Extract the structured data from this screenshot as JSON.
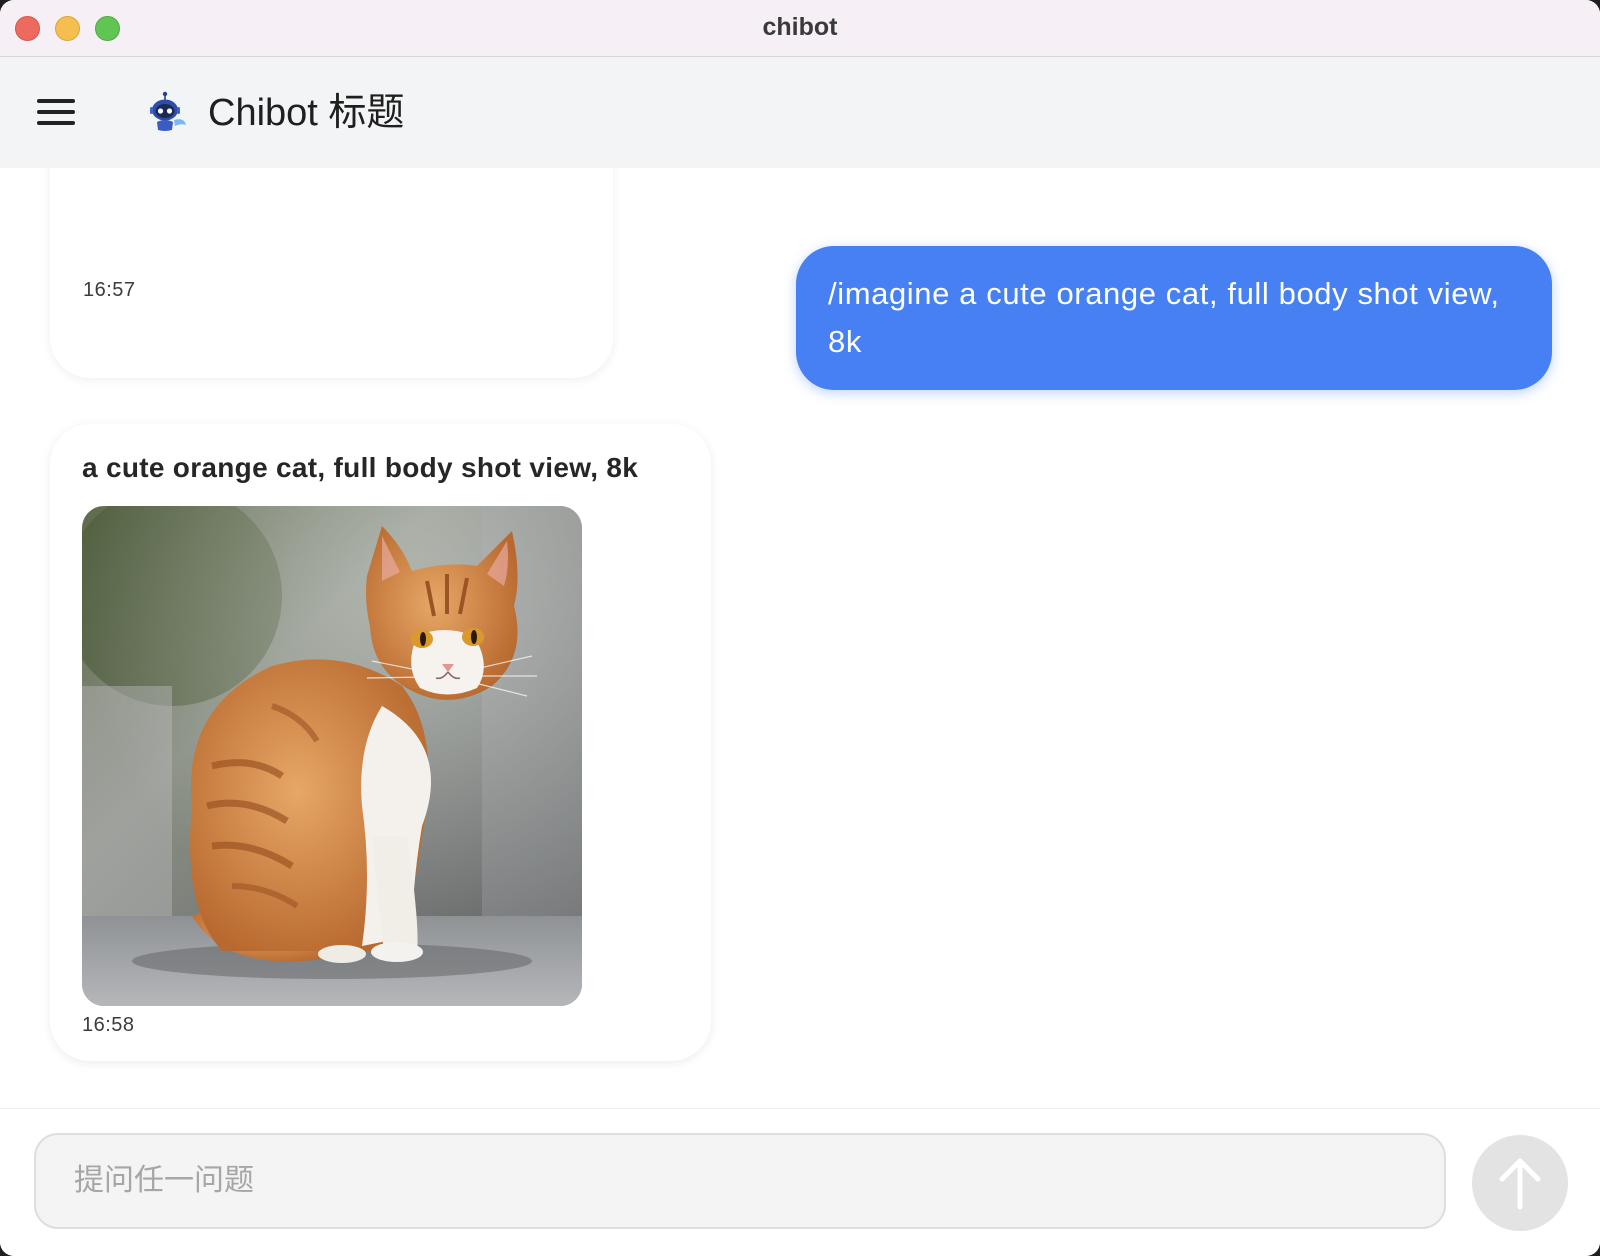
{
  "window": {
    "title": "chibot"
  },
  "header": {
    "title": "Chibot 标题",
    "logo_icon": "robot-icon",
    "menu_icon": "hamburger-menu-icon"
  },
  "messages": {
    "previous_bot": {
      "time": "16:57"
    },
    "user": {
      "text": "/imagine a cute orange cat, full body shot view, 8k"
    },
    "bot": {
      "heading": "a cute orange cat, full body shot view, 8k",
      "image_icon": "generated-cat-image",
      "time": "16:58"
    }
  },
  "composer": {
    "placeholder": "提问任一问题",
    "value": "",
    "send_icon": "arrow-up-icon"
  },
  "colors": {
    "accent": "#4680f2",
    "titlebar": "#f7eff6",
    "appbar": "#f3f4f6",
    "send_button": "#e3e3e3"
  }
}
